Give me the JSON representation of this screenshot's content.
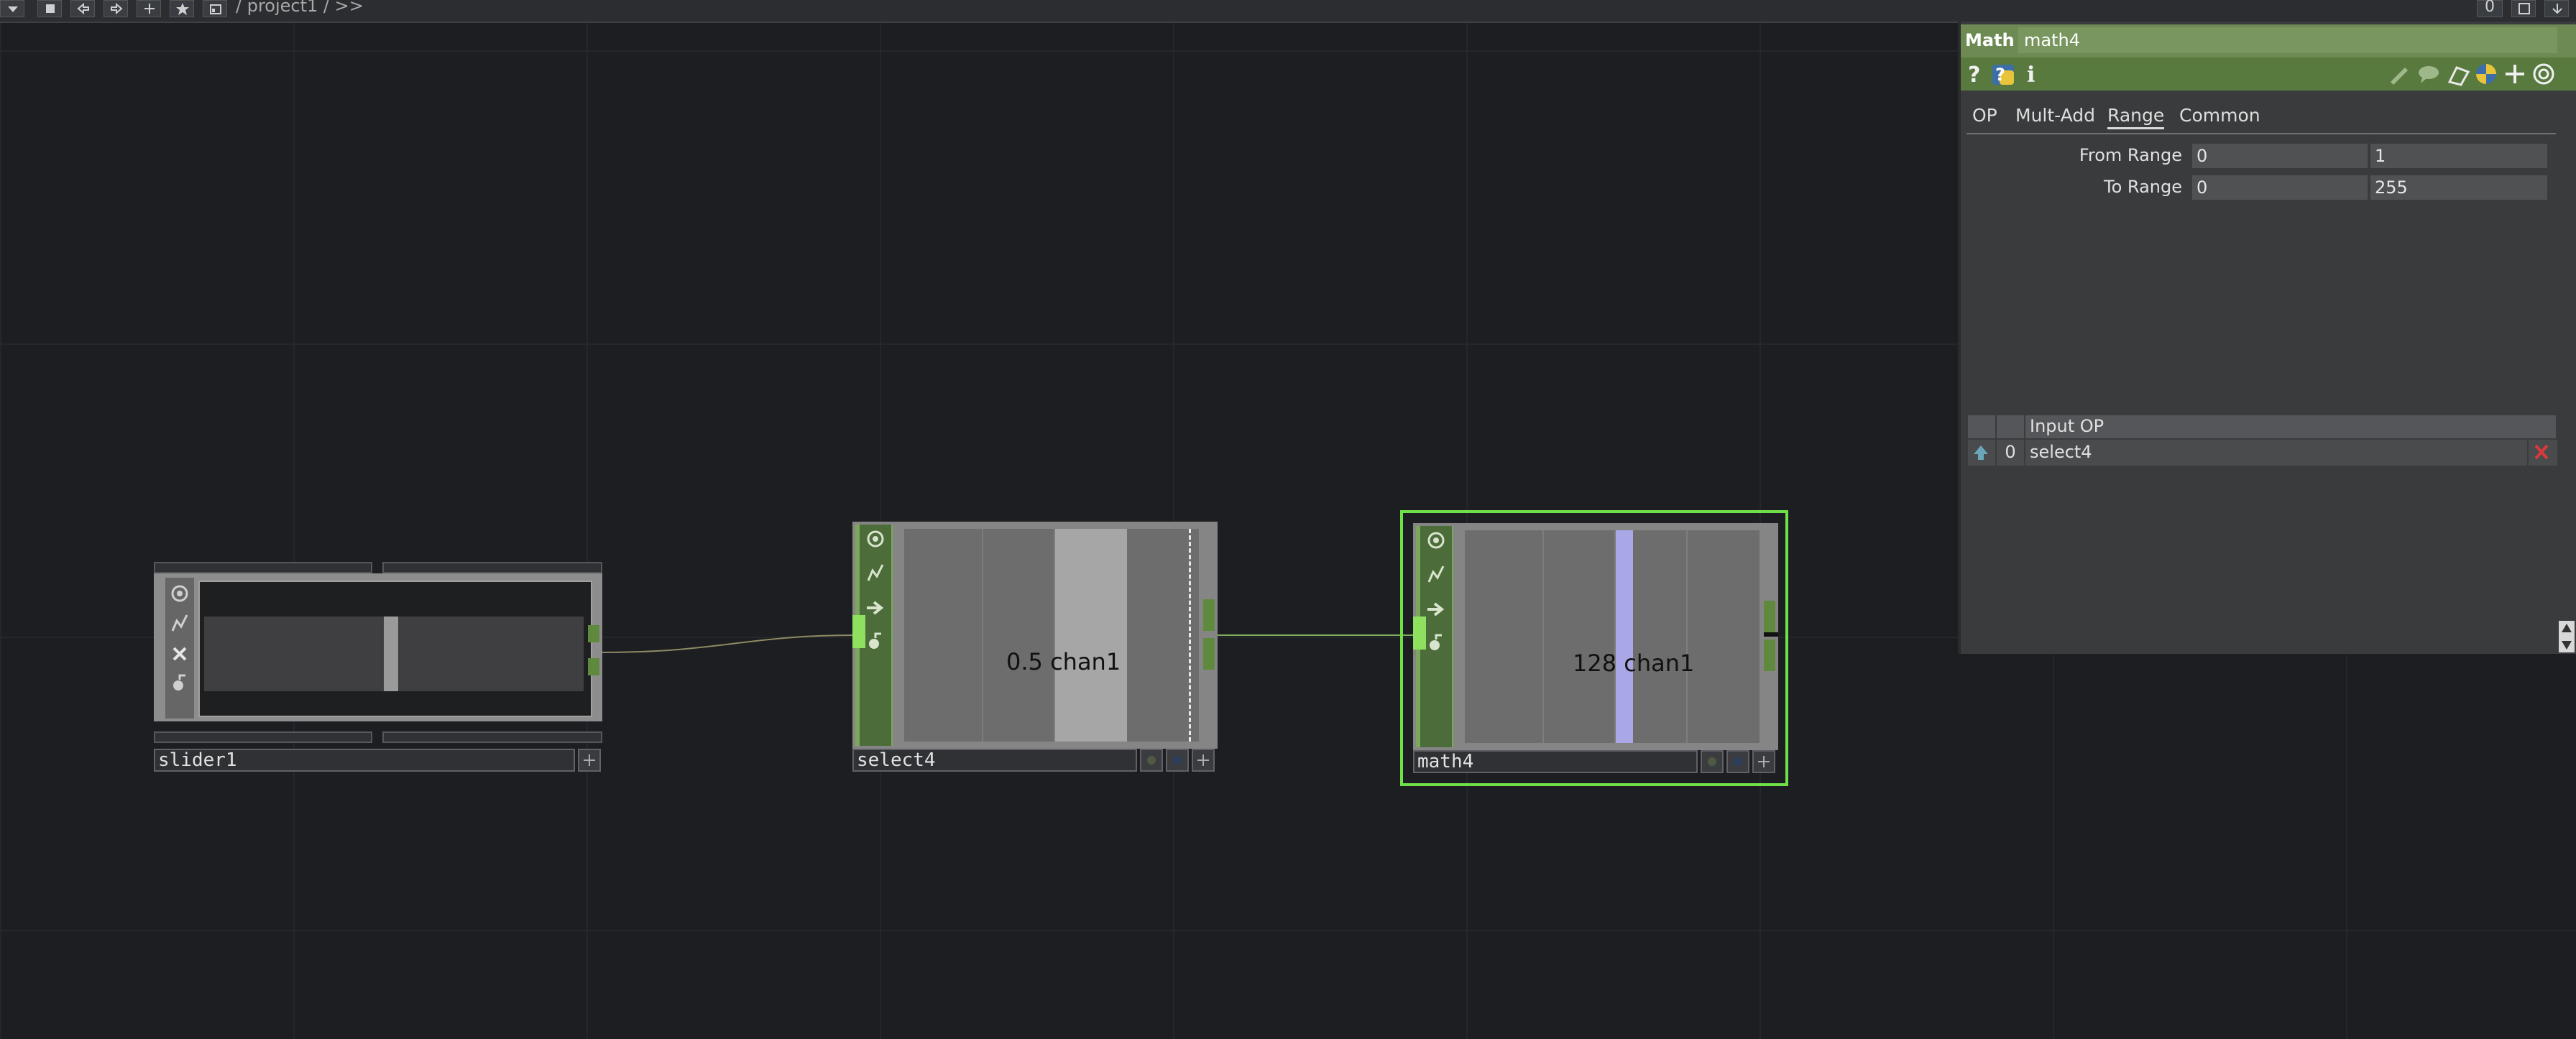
{
  "app": {
    "path": "/ project1 / >>",
    "top_right_counter": "0"
  },
  "nodes": {
    "slider": {
      "label": "slider1"
    },
    "select": {
      "label": "select4",
      "value": "0.5",
      "channel": "chan1"
    },
    "math": {
      "label": "math4",
      "value": "128",
      "channel": "chan1"
    }
  },
  "panel": {
    "op_type": "Math",
    "op_name": "math4",
    "tabs": [
      "OP",
      "Mult-Add",
      "Range",
      "Common"
    ],
    "active_tab": "Range",
    "params": [
      {
        "label": "From Range",
        "value1": "0",
        "value2": "1"
      },
      {
        "label": "To Range",
        "value1": "0",
        "value2": "255"
      }
    ],
    "inputs_header": "Input OP",
    "inputs": [
      {
        "index": "0",
        "op": "select4"
      }
    ]
  },
  "colors": {
    "node_green": "#4c6c3a",
    "selected_outline": "#6fe04a",
    "math_bar": "#a9a7e6",
    "select_bar": "#a6a6a6"
  }
}
